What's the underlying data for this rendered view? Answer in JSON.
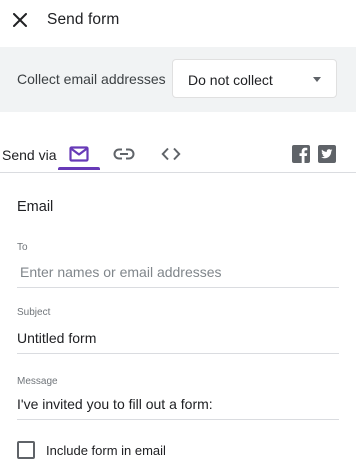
{
  "header": {
    "close_icon": "close-icon",
    "title": "Send form"
  },
  "collect": {
    "label": "Collect email addresses",
    "selected": "Do not collect"
  },
  "send_via": {
    "label": "Send via",
    "tabs": [
      {
        "icon": "email-icon",
        "selected": true
      },
      {
        "icon": "link-icon",
        "selected": false
      },
      {
        "icon": "embed-code-icon",
        "selected": false
      }
    ],
    "social": [
      "facebook-icon",
      "twitter-icon"
    ],
    "accent_color": "#673ab7"
  },
  "email": {
    "section_title": "Email",
    "to": {
      "label": "To",
      "placeholder": "Enter names or email addresses",
      "value": ""
    },
    "subject": {
      "label": "Subject",
      "value": "Untitled form"
    },
    "message": {
      "label": "Message",
      "value": "I've invited you to fill out a form:"
    },
    "include_form": {
      "label": "Include form in email",
      "checked": false
    }
  }
}
